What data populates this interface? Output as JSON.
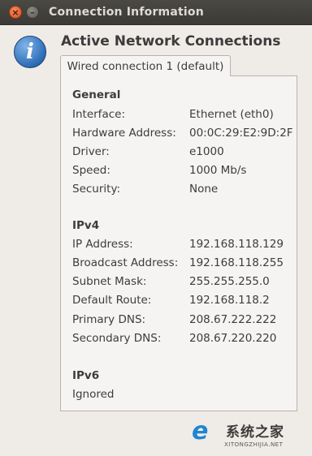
{
  "window": {
    "title": "Connection Information",
    "close_glyph": "×",
    "minimize_glyph": "–"
  },
  "header": {
    "icon": "info-icon",
    "heading": "Active Network Connections"
  },
  "tabs": [
    {
      "label": "Wired connection 1 (default)",
      "selected": true
    }
  ],
  "general": {
    "title": "General",
    "rows": [
      {
        "label": "Interface:",
        "value": "Ethernet (eth0)"
      },
      {
        "label": "Hardware Address:",
        "value": "00:0C:29:E2:9D:2F"
      },
      {
        "label": "Driver:",
        "value": "e1000"
      },
      {
        "label": "Speed:",
        "value": "1000 Mb/s"
      },
      {
        "label": "Security:",
        "value": "None"
      }
    ]
  },
  "ipv4": {
    "title": "IPv4",
    "rows": [
      {
        "label": "IP Address:",
        "value": "192.168.118.129"
      },
      {
        "label": "Broadcast Address:",
        "value": "192.168.118.255"
      },
      {
        "label": "Subnet Mask:",
        "value": "255.255.255.0"
      },
      {
        "label": "Default Route:",
        "value": "192.168.118.2"
      },
      {
        "label": "Primary DNS:",
        "value": "208.67.222.222"
      },
      {
        "label": "Secondary DNS:",
        "value": "208.67.220.220"
      }
    ]
  },
  "ipv6": {
    "title": "IPv6",
    "status": "Ignored"
  },
  "watermark": {
    "text": "系统之家",
    "sub": "XITONGZHIJIA.NET"
  },
  "colors": {
    "titlebar": "#3b3a36",
    "close_button": "#e0501d",
    "window_bg": "#efebe7",
    "info_icon": "#2d6db6"
  }
}
